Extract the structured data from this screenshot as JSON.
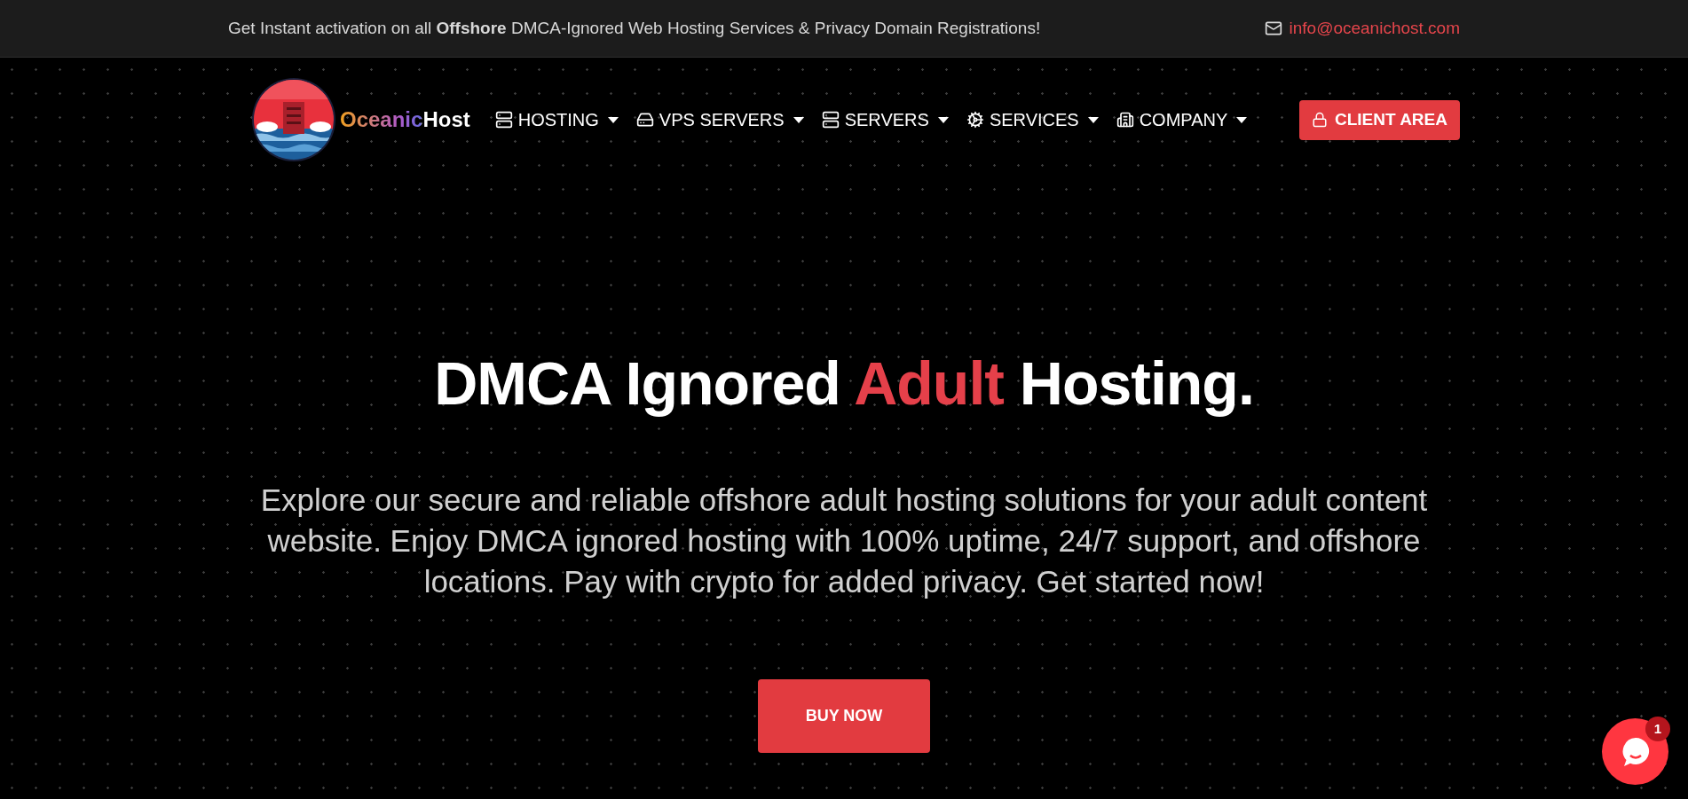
{
  "topbar": {
    "message": "Get Instant activation on all **Offshore** DMCA-Ignored Web Hosting Services & Privacy Domain Registrations!",
    "email": "info@oceanichost.com"
  },
  "logo": {
    "name": "OceanicHost"
  },
  "nav": [
    {
      "label": "HOSTING"
    },
    {
      "label": "VPS SERVERS"
    },
    {
      "label": "SERVERS"
    },
    {
      "label": "SERVICES"
    },
    {
      "label": "COMPANY"
    }
  ],
  "client_area": "CLIENT AREA",
  "hero": {
    "headline_before": "DMCA Ignored ",
    "headline_highlight": "Adult",
    "headline_after": " Hosting.",
    "description": "Explore our secure and reliable offshore adult hosting solutions for your adult content website. Enjoy DMCA ignored hosting with 100% uptime, 24/7 support, and offshore locations. Pay with crypto for added privacy. Get started now!",
    "button": "BUY NOW"
  },
  "chat": {
    "badge": "1"
  }
}
